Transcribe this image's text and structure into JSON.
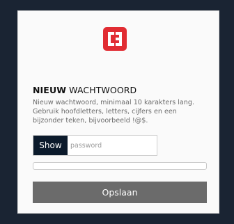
{
  "logo": {
    "icon": "c3-logo-icon",
    "color": "#e12c32"
  },
  "heading": {
    "bold": "NIEUW",
    "rest": " WACHTWOORD"
  },
  "description": "Nieuw wachtwoord, minimaal 10 karakters lang. Gebruik hoofdletters, letters, cijfers en een bijzonder teken, bijvoorbeeld !@$.",
  "password": {
    "show_label": "Show",
    "placeholder": "password",
    "value": ""
  },
  "strength": {
    "level": 0
  },
  "save_label": "Opslaan",
  "colors": {
    "page_background": "#1a2433",
    "show_button": "#0b1a2b",
    "save_button": "#6b6b6b"
  }
}
